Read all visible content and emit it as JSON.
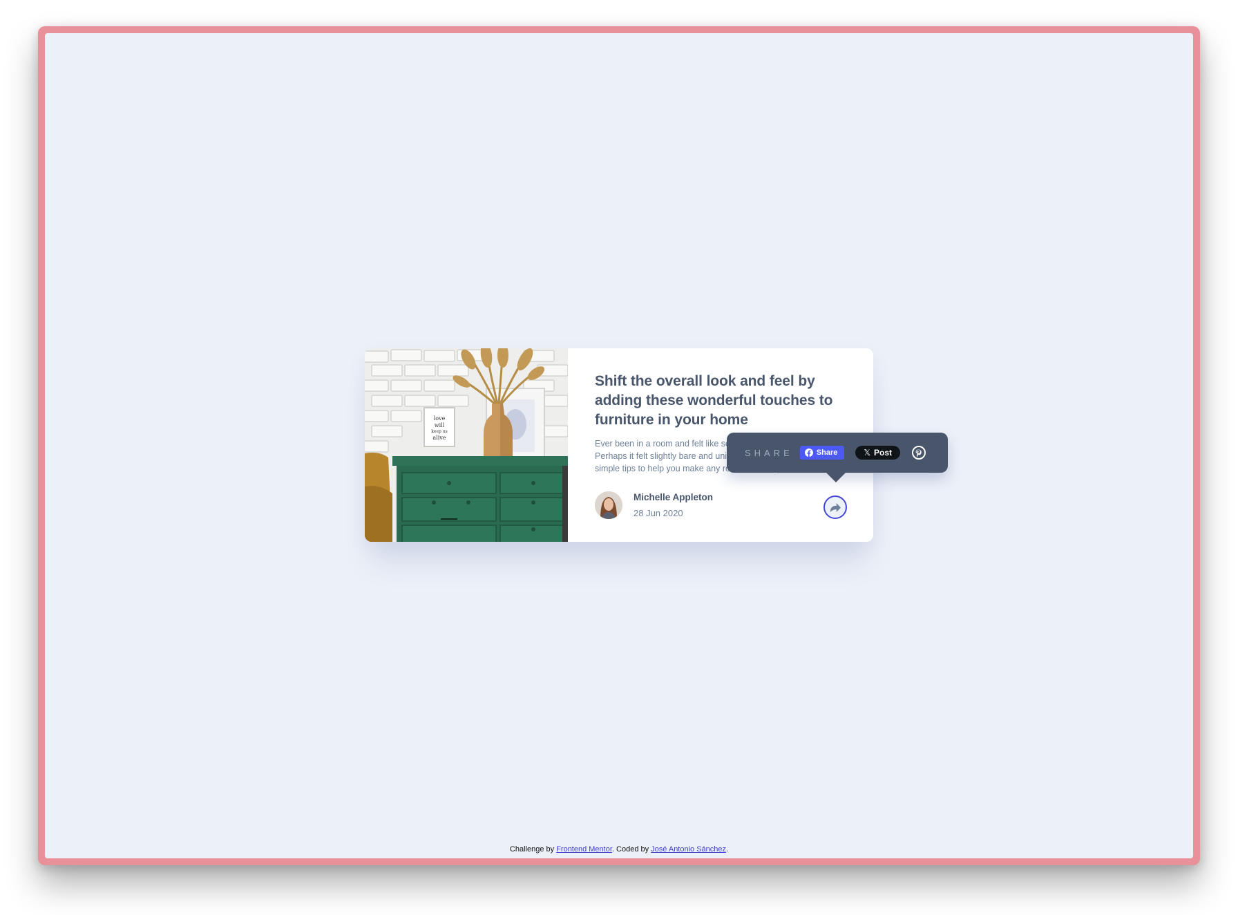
{
  "card": {
    "title": "Shift the overall look and feel by adding these wonderful touches to furniture in your home",
    "excerpt": "Ever been in a room and felt like something was missing? Perhaps it felt slightly bare and uninviting. I've got some simple tips to help you make any room feel complete.",
    "image_icon": "drawers-photo",
    "author": {
      "name": "Michelle Appleton",
      "date": "28 Jun 2020",
      "avatar_icon": "avatar-photo"
    },
    "share_button_icon": "share-arrow-icon"
  },
  "share_popup": {
    "label": "SHARE",
    "facebook": {
      "label": "Share",
      "icon": "facebook-icon"
    },
    "x": {
      "label": "Post",
      "glyph": "𝕏",
      "icon": "x-icon"
    },
    "pinterest": {
      "icon": "pinterest-icon"
    }
  },
  "attribution": {
    "prefix": "Challenge by ",
    "link1": "Frontend Mentor",
    "middle": ". Coded by ",
    "link2": "José Antonio Sánchez",
    "suffix": "."
  },
  "colors": {
    "frame": "#e8919a",
    "background": "#ecf0f8",
    "heading": "#48556a",
    "text": "#6e8098",
    "accent": "#4545d8",
    "popup": "#48556a",
    "facebook": "#4c59f5"
  }
}
